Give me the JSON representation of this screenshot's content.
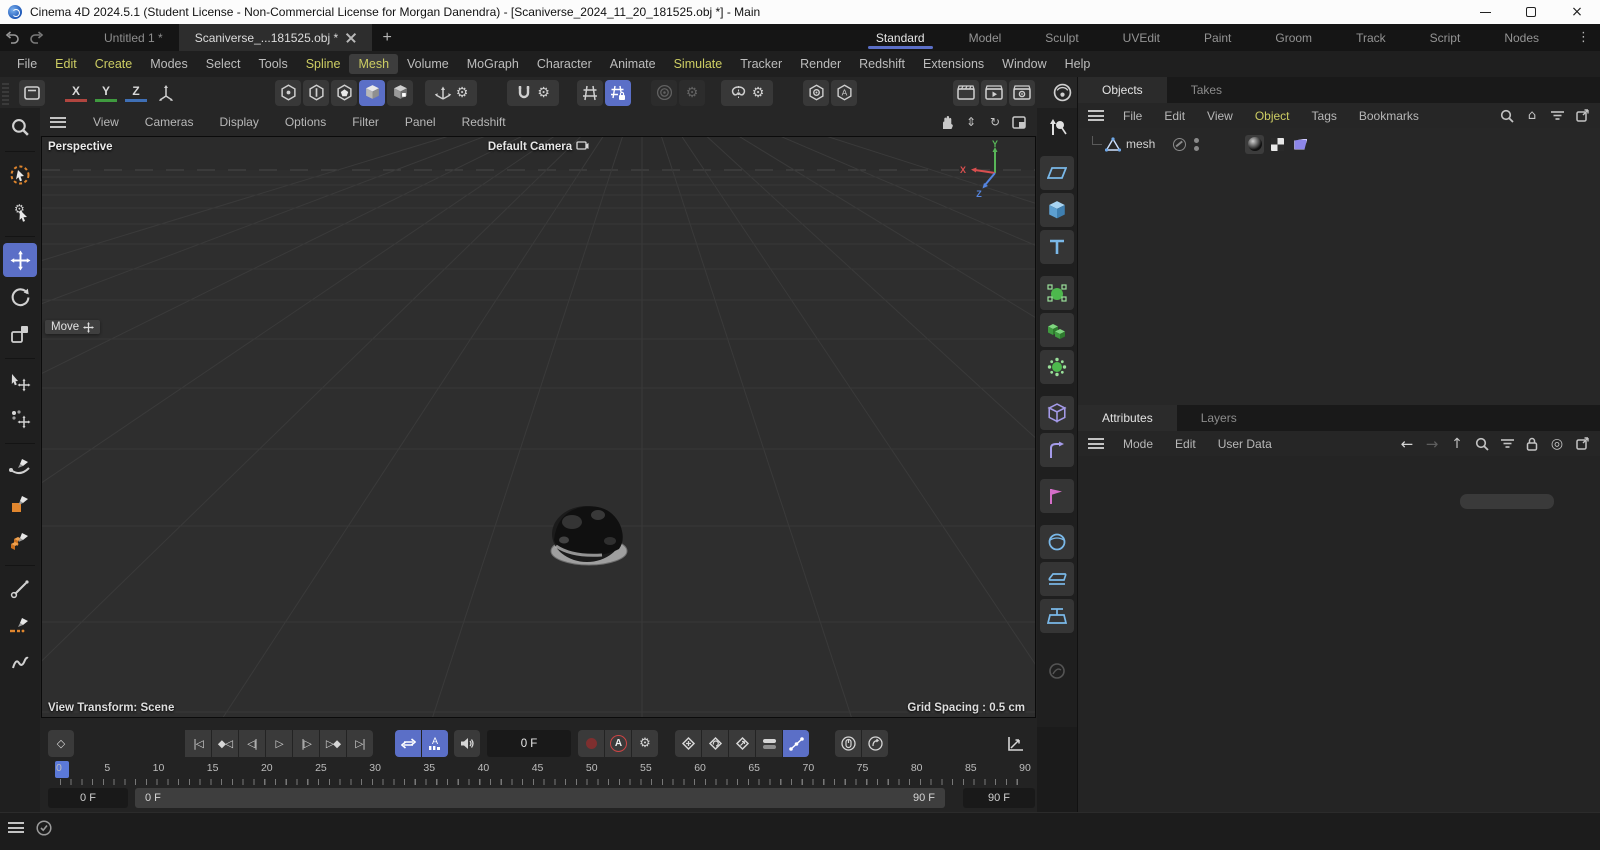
{
  "window": {
    "title": "Cinema 4D 2024.5.1 (Student License - Non-Commercial License for Morgan Danendra) - [Scaniverse_2024_11_20_181525.obj *] - Main"
  },
  "tab_bar": {
    "documents": [
      {
        "label": "Untitled 1 *",
        "name": "doc-tab-untitled"
      },
      {
        "label": "Scaniverse_...181525.obj *",
        "name": "doc-tab-scaniverse",
        "active": true
      }
    ],
    "add_label": "+",
    "layouts": [
      {
        "label": "Standard",
        "name": "layout-tab-standard",
        "active": true
      },
      {
        "label": "Model",
        "name": "layout-tab-model"
      },
      {
        "label": "Sculpt",
        "name": "layout-tab-sculpt"
      },
      {
        "label": "UVEdit",
        "name": "layout-tab-uvedit"
      },
      {
        "label": "Paint",
        "name": "layout-tab-paint"
      },
      {
        "label": "Groom",
        "name": "layout-tab-groom"
      },
      {
        "label": "Track",
        "name": "layout-tab-track"
      },
      {
        "label": "Script",
        "name": "layout-tab-script"
      },
      {
        "label": "Nodes",
        "name": "layout-tab-nodes"
      }
    ]
  },
  "menu_bar": {
    "items": [
      {
        "label": "File",
        "name": "menu-file"
      },
      {
        "label": "Edit",
        "name": "menu-edit",
        "accent": true
      },
      {
        "label": "Create",
        "name": "menu-create",
        "accent": true
      },
      {
        "label": "Modes",
        "name": "menu-modes"
      },
      {
        "label": "Select",
        "name": "menu-select"
      },
      {
        "label": "Tools",
        "name": "menu-tools"
      },
      {
        "label": "Spline",
        "name": "menu-spline",
        "accent": true
      },
      {
        "label": "Mesh",
        "name": "menu-mesh",
        "accent": true,
        "boxed": true
      },
      {
        "label": "Volume",
        "name": "menu-volume"
      },
      {
        "label": "MoGraph",
        "name": "menu-mograph"
      },
      {
        "label": "Character",
        "name": "menu-character"
      },
      {
        "label": "Animate",
        "name": "menu-animate"
      },
      {
        "label": "Simulate",
        "name": "menu-simulate",
        "accent": true
      },
      {
        "label": "Tracker",
        "name": "menu-tracker"
      },
      {
        "label": "Render",
        "name": "menu-render"
      },
      {
        "label": "Redshift",
        "name": "menu-redshift"
      },
      {
        "label": "Extensions",
        "name": "menu-extensions"
      },
      {
        "label": "Window",
        "name": "menu-window"
      },
      {
        "label": "Help",
        "name": "menu-help"
      }
    ]
  },
  "toolbar": {
    "axis_x": "X",
    "axis_y": "Y",
    "axis_z": "Z"
  },
  "viewport": {
    "menu_items": [
      "View",
      "Cameras",
      "Display",
      "Options",
      "Filter",
      "Panel",
      "Redshift"
    ],
    "view_label": "Perspective",
    "camera_label": "Default Camera",
    "tool_hint": "Move",
    "status_left": "View Transform: Scene",
    "status_right": "Grid Spacing : 0.5 cm",
    "axis": {
      "x": "X",
      "y": "Y",
      "z": "Z"
    },
    "colors": {
      "axis_x": "#d94f4f",
      "axis_y": "#58b558",
      "axis_z": "#5585e0"
    }
  },
  "object_manager": {
    "tabs": [
      {
        "label": "Objects",
        "name": "tab-objects",
        "active": true
      },
      {
        "label": "Takes",
        "name": "tab-takes"
      }
    ],
    "menu_items": [
      {
        "label": "File",
        "name": "om-menu-file"
      },
      {
        "label": "Edit",
        "name": "om-menu-edit"
      },
      {
        "label": "View",
        "name": "om-menu-view"
      },
      {
        "label": "Object",
        "name": "om-menu-object",
        "accent": true
      },
      {
        "label": "Tags",
        "name": "om-menu-tags"
      },
      {
        "label": "Bookmarks",
        "name": "om-menu-bookmarks"
      }
    ],
    "object_label": "mesh"
  },
  "attribute_manager": {
    "tabs": [
      {
        "label": "Attributes",
        "name": "tab-attributes",
        "active": true
      },
      {
        "label": "Layers",
        "name": "tab-layers"
      }
    ],
    "menu_items": [
      {
        "label": "Mode",
        "name": "am-menu-mode"
      },
      {
        "label": "Edit",
        "name": "am-menu-edit"
      },
      {
        "label": "User Data",
        "name": "am-menu-user-data"
      }
    ]
  },
  "timeline": {
    "current_frame": "0 F",
    "autokey_label": "A",
    "transport": [
      {
        "glyph": "|◁",
        "name": "goto-start-button"
      },
      {
        "glyph": "◆◁",
        "name": "prev-key-button"
      },
      {
        "glyph": "◁|",
        "name": "prev-frame-button"
      },
      {
        "glyph": "▷",
        "name": "play-button"
      },
      {
        "glyph": "|▷",
        "name": "next-frame-button"
      },
      {
        "glyph": "▷◆",
        "name": "next-key-button"
      },
      {
        "glyph": "▷|",
        "name": "goto-end-button"
      }
    ],
    "ruler_ticks": [
      "0",
      "5",
      "10",
      "15",
      "20",
      "25",
      "30",
      "35",
      "40",
      "45",
      "50",
      "55",
      "60",
      "65",
      "70",
      "75",
      "80",
      "85",
      "90"
    ],
    "range_start_field": "0 F",
    "range_bar_start": "0 F",
    "range_bar_end": "90 F",
    "range_end_field": "90 F"
  },
  "colors": {
    "selection_blue": "#5b6fc7",
    "menu_accent_yellow": "#cdcd63",
    "tool_orange": "#e0862e"
  }
}
